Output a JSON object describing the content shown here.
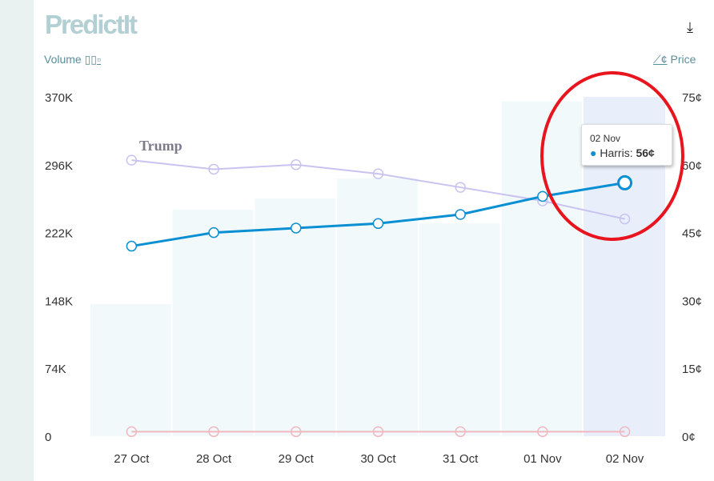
{
  "header": {
    "logo": "PredictIt",
    "volume_label": "Volume",
    "price_label": "Price",
    "download_icon": "download-icon"
  },
  "tooltip": {
    "date": "02 Nov",
    "series": "Harris:",
    "value": "56¢"
  },
  "chart_data": {
    "type": "bar+line",
    "categories": [
      "27 Oct",
      "28 Oct",
      "29 Oct",
      "30 Oct",
      "31 Oct",
      "01 Nov",
      "02 Nov"
    ],
    "volume": {
      "values": [
        144000,
        247000,
        259000,
        281000,
        232000,
        365000,
        370000
      ],
      "ylim": [
        0,
        370000
      ],
      "ticks": [
        "0",
        "74K",
        "148K",
        "222K",
        "296K",
        "370K"
      ]
    },
    "price_axis": {
      "ylim": [
        0,
        75
      ],
      "ticks": [
        "0¢",
        "15¢",
        "30¢",
        "45¢",
        "60¢",
        "75¢"
      ]
    },
    "series": [
      {
        "name": "Harris",
        "values": [
          42,
          45,
          46,
          47,
          49,
          53,
          56
        ],
        "color": "#0b8fd3"
      },
      {
        "name": "Trump",
        "values": [
          61,
          59,
          60,
          58,
          55,
          52,
          48
        ],
        "color": "#c9c3f0"
      },
      {
        "values": [
          1,
          1,
          1,
          1,
          1,
          1,
          1
        ],
        "color": "#f0b8c0"
      }
    ],
    "annotations": [
      "Trump"
    ],
    "highlight_category": "02 Nov"
  }
}
